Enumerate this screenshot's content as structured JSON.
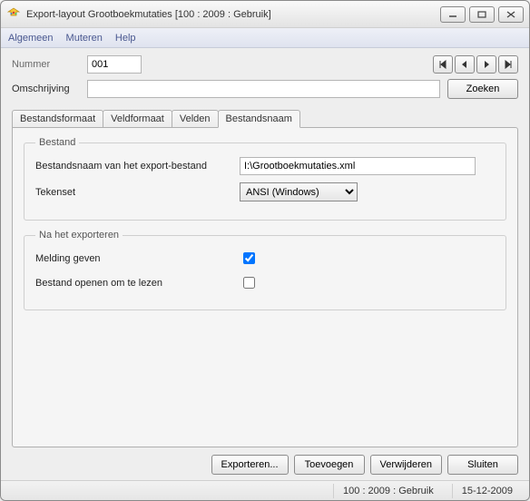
{
  "window": {
    "title": "Export-layout Grootboekmutaties  [100 : 2009 : Gebruik]"
  },
  "menu": {
    "algemeen": "Algemeen",
    "muteren": "Muteren",
    "help": "Help"
  },
  "top": {
    "nummer_label": "Nummer",
    "nummer_value": "001",
    "omschrijving_label": "Omschrijving",
    "omschrijving_value": "",
    "zoeken": "Zoeken"
  },
  "tabs": {
    "t0": "Bestandsformaat",
    "t1": "Veldformaat",
    "t2": "Velden",
    "t3": "Bestandsnaam"
  },
  "bestand": {
    "legend": "Bestand",
    "path_label": "Bestandsnaam van het export-bestand",
    "path_value": "I:\\Grootboekmutaties.xml",
    "tekenset_label": "Tekenset",
    "tekenset_value": "ANSI (Windows)"
  },
  "na": {
    "legend": "Na het exporteren",
    "melding_label": "Melding geven",
    "melding_checked": true,
    "openen_label": "Bestand openen om te lezen",
    "openen_checked": false
  },
  "buttons": {
    "exporteren": "Exporteren...",
    "toevoegen": "Toevoegen",
    "verwijderen": "Verwijderen",
    "sluiten": "Sluiten"
  },
  "status": {
    "context": "100 : 2009 : Gebruik",
    "date": "15-12-2009"
  }
}
